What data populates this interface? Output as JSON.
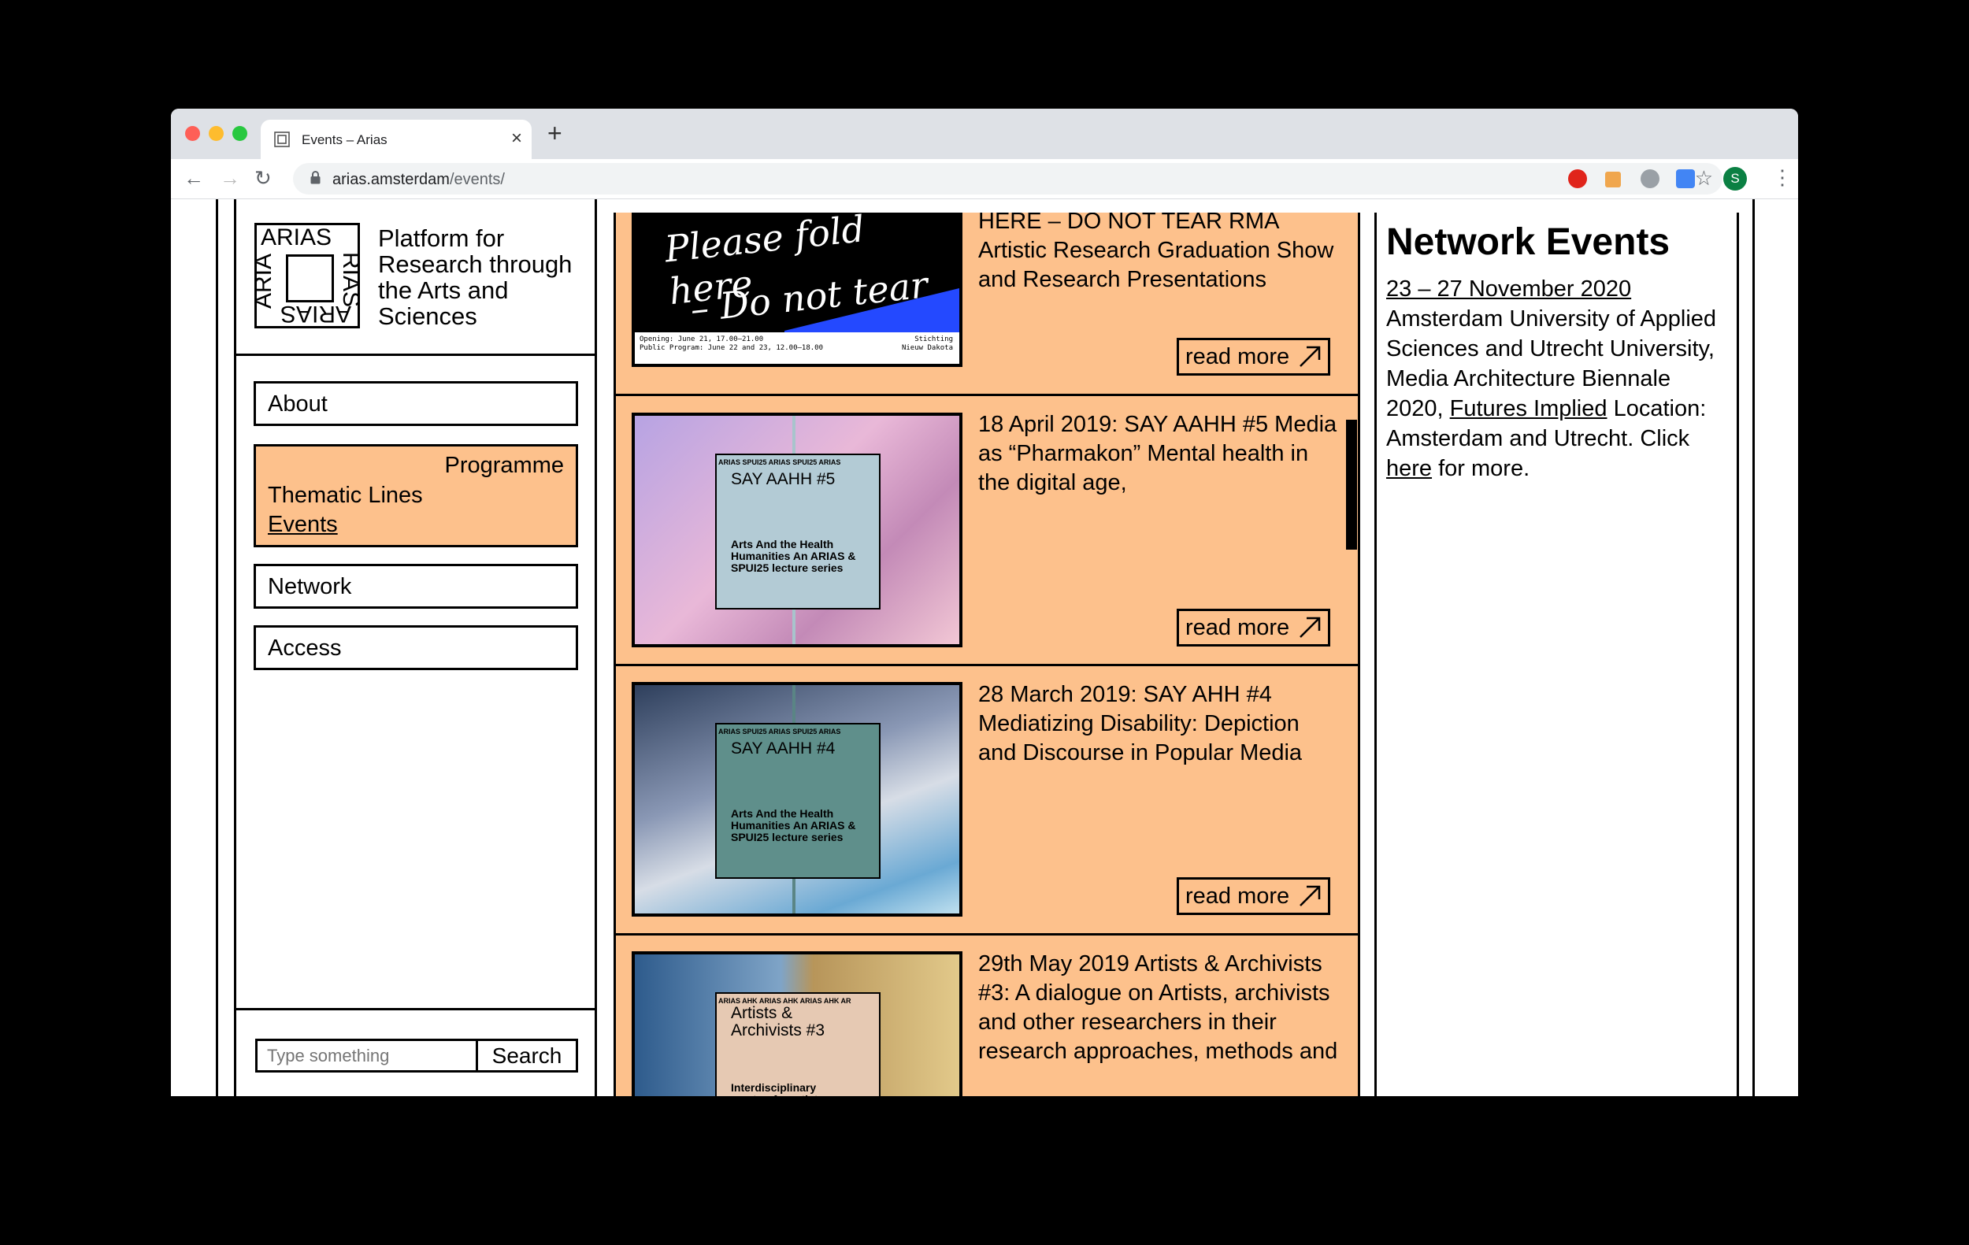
{
  "browser": {
    "tab_title": "Events – Arias",
    "url_host": "arias.amsterdam",
    "url_path": "/events/",
    "avatar_letter": "S"
  },
  "logo": {
    "top": "ARIAS",
    "bottom": "ARIAS",
    "left": "ARIA",
    "right": "RIAS"
  },
  "tagline": "Platform for Research through the Arts and Sciences",
  "nav": {
    "about": "About",
    "programme": "Programme",
    "thematic_lines": "Thematic Lines",
    "events": "Events",
    "network": "Network",
    "access": "Access"
  },
  "search": {
    "placeholder": "Type something",
    "button": "Search"
  },
  "events": [
    {
      "title": "HERE – DO NOT TEAR RMA Artistic Research Graduation Show and Research Presentations",
      "read_more": "read more",
      "poster_script_1": "Please fold here",
      "poster_script_2": "– Do not tear",
      "poster_info_left_1": "Opening: June 21, 17.00–21.00",
      "poster_info_left_2": "Public Program: June 22 and 23, 12.00–18.00",
      "poster_info_right_1": "Stichting",
      "poster_info_right_2": "Nieuw Dakota"
    },
    {
      "title": "18 April 2019: SAY AAHH #5 Media as “Pharmakon” Mental health in the digital age,",
      "read_more": "read more",
      "poster_heading": "SAY AAHH #5",
      "poster_strip": "ARIAS SPUI25 ARIAS SPUI25 ARIAS",
      "poster_body": "Arts And the Health Humanities An ARIAS & SPUI25 lecture series"
    },
    {
      "title": "28 March 2019: SAY AHH #4 Mediatizing Disability: Depiction and Discourse in Popular Media",
      "read_more": "read more",
      "poster_heading": "SAY AAHH #4",
      "poster_strip": "ARIAS SPUI25 ARIAS SPUI25 ARIAS",
      "poster_body": "Arts And the Health Humanities An ARIAS & SPUI25 lecture series"
    },
    {
      "title": "29th May 2019 Artists & Archivists #3: A dialogue on Artists, archivists and other researchers in their research approaches, methods and",
      "poster_heading": "Artists & Archivists #3",
      "poster_strip": "ARIAS AHK ARIAS AHK ARIAS AHK AR",
      "poster_body": "Interdisciplinary meetup for artists"
    }
  ],
  "network_events": {
    "title": "Network Events",
    "date": "23 – 27 November 2020",
    "text_1": "Amsterdam University of Applied Sciences and Utrecht University, Media Architecture Biennale 2020,",
    "link_1": "Futures Implied",
    "text_2": "Location: Amsterdam and Utrecht. Click",
    "link_2": "here",
    "text_3": "for more."
  },
  "colors": {
    "accent": "#fdc18c",
    "border": "#000000"
  }
}
